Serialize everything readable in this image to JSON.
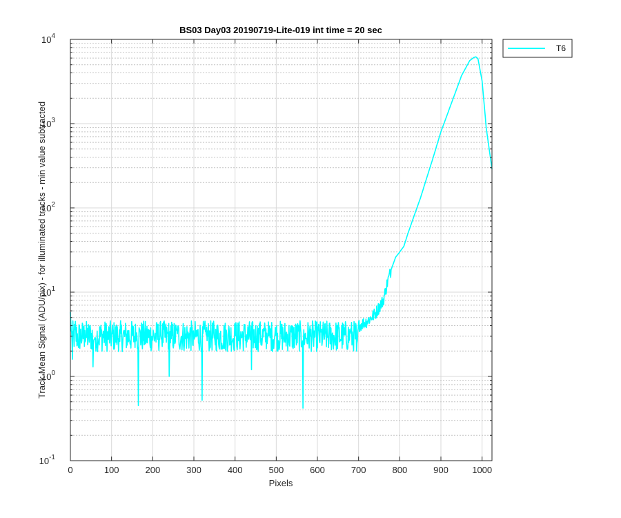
{
  "chart_data": {
    "type": "line",
    "title": "BS03 Day03 20190719-Lite-019 int time = 20 sec",
    "xlabel": "Pixels",
    "ylabel": "Track Mean Signal (ADU/pix) - for illuminated tracks - min value subtracted",
    "xlim": [
      0,
      1024
    ],
    "ylim": [
      0.1,
      10000
    ],
    "yscale": "log",
    "grid": true,
    "minor_grid": true,
    "xticks": [
      0,
      100,
      200,
      300,
      400,
      500,
      600,
      700,
      800,
      900,
      1000
    ],
    "yticks": [
      {
        "value": 0.1,
        "base": "10",
        "exp": "-1"
      },
      {
        "value": 1,
        "base": "10",
        "exp": "0"
      },
      {
        "value": 10,
        "base": "10",
        "exp": "1"
      },
      {
        "value": 100,
        "base": "10",
        "exp": "2"
      },
      {
        "value": 1000,
        "base": "10",
        "exp": "3"
      },
      {
        "value": 10000,
        "base": "10",
        "exp": "4"
      }
    ],
    "legend_position": "outside-top-right",
    "series": [
      {
        "name": "T6",
        "color": "#00ffff",
        "noise_region": {
          "x_start": 0,
          "x_end": 695,
          "baseline": 3.0
        },
        "x": [
          0,
          5,
          12,
          20,
          35,
          55,
          60,
          80,
          100,
          120,
          140,
          160,
          165,
          170,
          190,
          200,
          220,
          240,
          245,
          260,
          280,
          300,
          320,
          330,
          350,
          380,
          400,
          430,
          440,
          460,
          480,
          500,
          520,
          560,
          565,
          570,
          590,
          620,
          650,
          680,
          690,
          695,
          700,
          720,
          740,
          760,
          770,
          780,
          790,
          800,
          810,
          820,
          850,
          880,
          900,
          930,
          950,
          970,
          980,
          985,
          990,
          1000,
          1010,
          1024
        ],
        "y": [
          5.8,
          1.6,
          4.5,
          2.2,
          3.5,
          1.3,
          2.9,
          3.4,
          3.0,
          2.6,
          3.2,
          2.8,
          0.45,
          3.3,
          2.9,
          2.7,
          3.0,
          1.0,
          2.8,
          3.2,
          2.8,
          3.0,
          0.52,
          3.1,
          2.9,
          3.1,
          3.0,
          2.9,
          1.2,
          3.2,
          3.0,
          3.1,
          3.0,
          3.3,
          0.42,
          3.2,
          3.4,
          3.3,
          3.5,
          3.4,
          3.9,
          2.0,
          4.0,
          4.5,
          5.5,
          8.0,
          13,
          19,
          26,
          30,
          35,
          50,
          130,
          380,
          800,
          2000,
          3700,
          5600,
          6100,
          6200,
          5900,
          3200,
          900,
          290
        ]
      }
    ]
  }
}
